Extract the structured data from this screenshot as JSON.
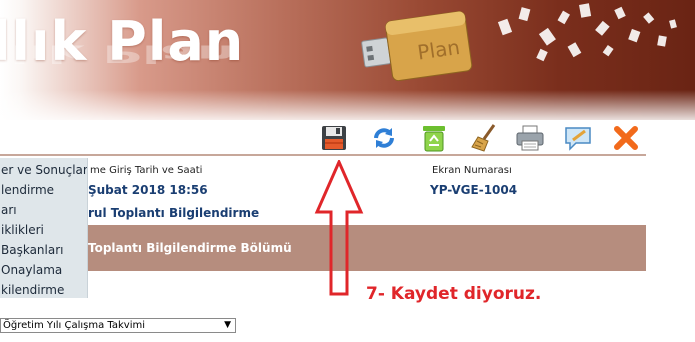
{
  "banner": {
    "title": "llık Plan",
    "usb_label": "Plan"
  },
  "toolbar": {
    "buttons": [
      {
        "name": "save",
        "icon": "floppy-disk-icon"
      },
      {
        "name": "refresh",
        "icon": "refresh-icon"
      },
      {
        "name": "recycle",
        "icon": "recycle-bin-icon"
      },
      {
        "name": "clear",
        "icon": "broom-icon"
      },
      {
        "name": "print",
        "icon": "printer-icon"
      },
      {
        "name": "comment",
        "icon": "speech-bubble-icon"
      },
      {
        "name": "close",
        "icon": "close-icon"
      }
    ]
  },
  "sidebar": {
    "items": [
      {
        "label": "er ve Sonuçlar"
      },
      {
        "label": "lendirme"
      },
      {
        "label": "arı"
      },
      {
        "label": "iklikleri"
      },
      {
        "label": "Başkanları"
      },
      {
        "label": "Onaylama"
      },
      {
        "label": "kilendirme"
      }
    ]
  },
  "info": {
    "date_label": "me Giriş Tarih ve Saati",
    "date_value": "Şubat 2018 18:56",
    "screen_label": "Ekran Numarası",
    "screen_value": "YP-VGE-1004"
  },
  "section": {
    "link": "rul Toplantı Bilgilendirme",
    "band_title": "Toplantı Bilgilendirme Bölümü"
  },
  "annotation": {
    "text": "7- Kaydet diyoruz."
  },
  "select": {
    "value": "Öğretim Yılı Çalışma Takvimi"
  },
  "colors": {
    "accent_band": "#b68d7e",
    "link_blue": "#1a3e72",
    "annotation_red": "#e0262a"
  }
}
